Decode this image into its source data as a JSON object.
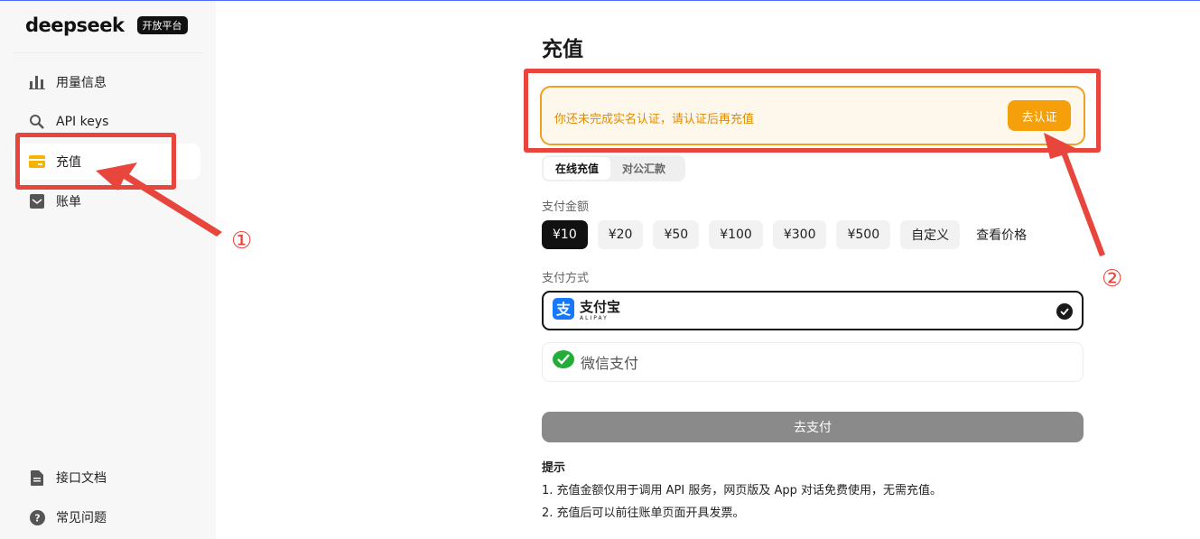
{
  "brand": {
    "logo": "deepseek",
    "badge": "开放平台"
  },
  "sidebar": {
    "items": [
      {
        "label": "用量信息",
        "icon": "bar-chart-icon"
      },
      {
        "label": "API keys",
        "icon": "search-key-icon"
      },
      {
        "label": "充值",
        "icon": "card-icon",
        "active": true
      },
      {
        "label": "账单",
        "icon": "bill-icon"
      }
    ],
    "bottom_items": [
      {
        "label": "接口文档",
        "icon": "doc-icon"
      },
      {
        "label": "常见问题",
        "icon": "help-icon"
      }
    ]
  },
  "main": {
    "title": "充值",
    "notice": {
      "text": "你还未完成实名认证，请认证后再充值",
      "button": "去认证"
    },
    "tabs": [
      {
        "label": "在线充值",
        "active": true
      },
      {
        "label": "对公汇款",
        "active": false
      }
    ],
    "amount_label": "支付金额",
    "amounts": [
      "¥10",
      "¥20",
      "¥50",
      "¥100",
      "¥300",
      "¥500",
      "自定义"
    ],
    "selected_amount": "¥10",
    "price_link": "查看价格",
    "method_label": "支付方式",
    "methods": {
      "alipay": {
        "label": "支付宝",
        "sub": "ALIPAY",
        "selected": true
      },
      "wechat": {
        "label": "微信支付",
        "selected": false
      }
    },
    "pay_button": "去支付",
    "tips": {
      "title": "提示",
      "items": [
        "1. 充值金额仅用于调用 API 服务，网页版及 App 对话免费使用，无需充值。",
        "2. 充值后可以前往账单页面开具发票。"
      ]
    }
  },
  "annotations": {
    "marker1": "①",
    "marker2": "②",
    "color": "#e8453c"
  },
  "colors": {
    "accent": "#f5a00b",
    "notice_border": "#f0a020",
    "notice_text": "#e08a00",
    "selected": "#111111"
  }
}
